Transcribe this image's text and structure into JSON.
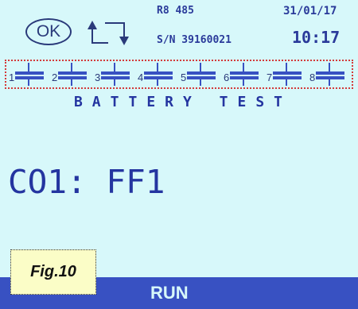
{
  "header": {
    "ok_label": "OK",
    "model": "R8 485",
    "serial": "S/N 39160021",
    "date": "31/01/17",
    "time": "10:17"
  },
  "icons": {
    "ok": "ok-button",
    "cycle": "cycle-arrows-icon",
    "cell": "battery-cell-icon"
  },
  "cells": [
    "1",
    "2",
    "3",
    "4",
    "5",
    "6",
    "7",
    "8"
  ],
  "title": "BATTERY TEST",
  "code_display": "CO1: FF1",
  "status": "RUN",
  "figure_label": "Fig.10",
  "colors": {
    "screen_bg": "#d7f8fa",
    "text_blue": "#2435a0",
    "status_bar": "#3851c2",
    "cell_strip_border": "#d33a3a",
    "label_bg": "#fbfdc7"
  }
}
